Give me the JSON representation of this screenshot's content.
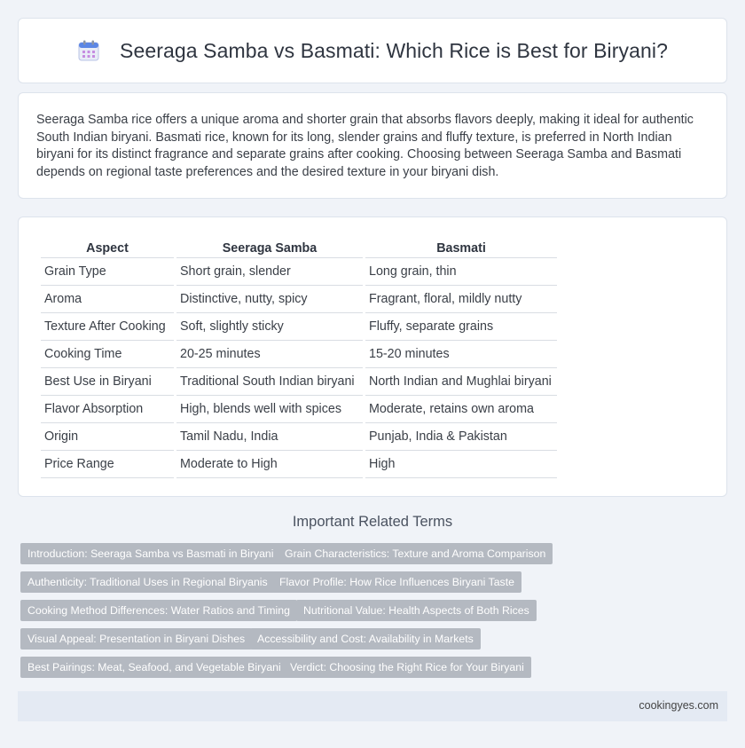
{
  "header": {
    "title": "Seeraga Samba vs Basmati: Which Rice is Best for Biryani?"
  },
  "intro": {
    "text": "Seeraga Samba rice offers a unique aroma and shorter grain that absorbs flavors deeply, making it ideal for authentic South Indian biryani. Basmati rice, known for its long, slender grains and fluffy texture, is preferred in North Indian biryani for its distinct fragrance and separate grains after cooking. Choosing between Seeraga Samba and Basmati depends on regional taste preferences and the desired texture in your biryani dish."
  },
  "table": {
    "headers": [
      "Aspect",
      "Seeraga Samba",
      "Basmati"
    ],
    "rows": [
      [
        "Grain Type",
        "Short grain, slender",
        "Long grain, thin"
      ],
      [
        "Aroma",
        "Distinctive, nutty, spicy",
        "Fragrant, floral, mildly nutty"
      ],
      [
        "Texture After Cooking",
        "Soft, slightly sticky",
        "Fluffy, separate grains"
      ],
      [
        "Cooking Time",
        "20-25 minutes",
        "15-20 minutes"
      ],
      [
        "Best Use in Biryani",
        "Traditional South Indian biryani",
        "North Indian and Mughlai biryani"
      ],
      [
        "Flavor Absorption",
        "High, blends well with spices",
        "Moderate, retains own aroma"
      ],
      [
        "Origin",
        "Tamil Nadu, India",
        "Punjab, India & Pakistan"
      ],
      [
        "Price Range",
        "Moderate to High",
        "High"
      ]
    ]
  },
  "related": {
    "title": "Important Related Terms",
    "tags": [
      "Introduction: Seeraga Samba vs Basmati in Biryani",
      "Grain Characteristics: Texture and Aroma Comparison",
      "Authenticity: Traditional Uses in Regional Biryanis",
      "Flavor Profile: How Rice Influences Biryani Taste",
      "Cooking Method Differences: Water Ratios and Timing",
      "Nutritional Value: Health Aspects of Both Rices",
      "Visual Appeal: Presentation in Biryani Dishes",
      "Accessibility and Cost: Availability in Markets",
      "Best Pairings: Meat, Seafood, and Vegetable Biryani",
      "Verdict: Choosing the Right Rice for Your Biryani"
    ]
  },
  "footer": {
    "site": "cookingyes.com"
  },
  "icons": {
    "header_icon": "calendar-icon"
  },
  "colors": {
    "background": "#f0f3f8",
    "tag": "#b4b9c1",
    "footer": "#e4eaf3"
  }
}
